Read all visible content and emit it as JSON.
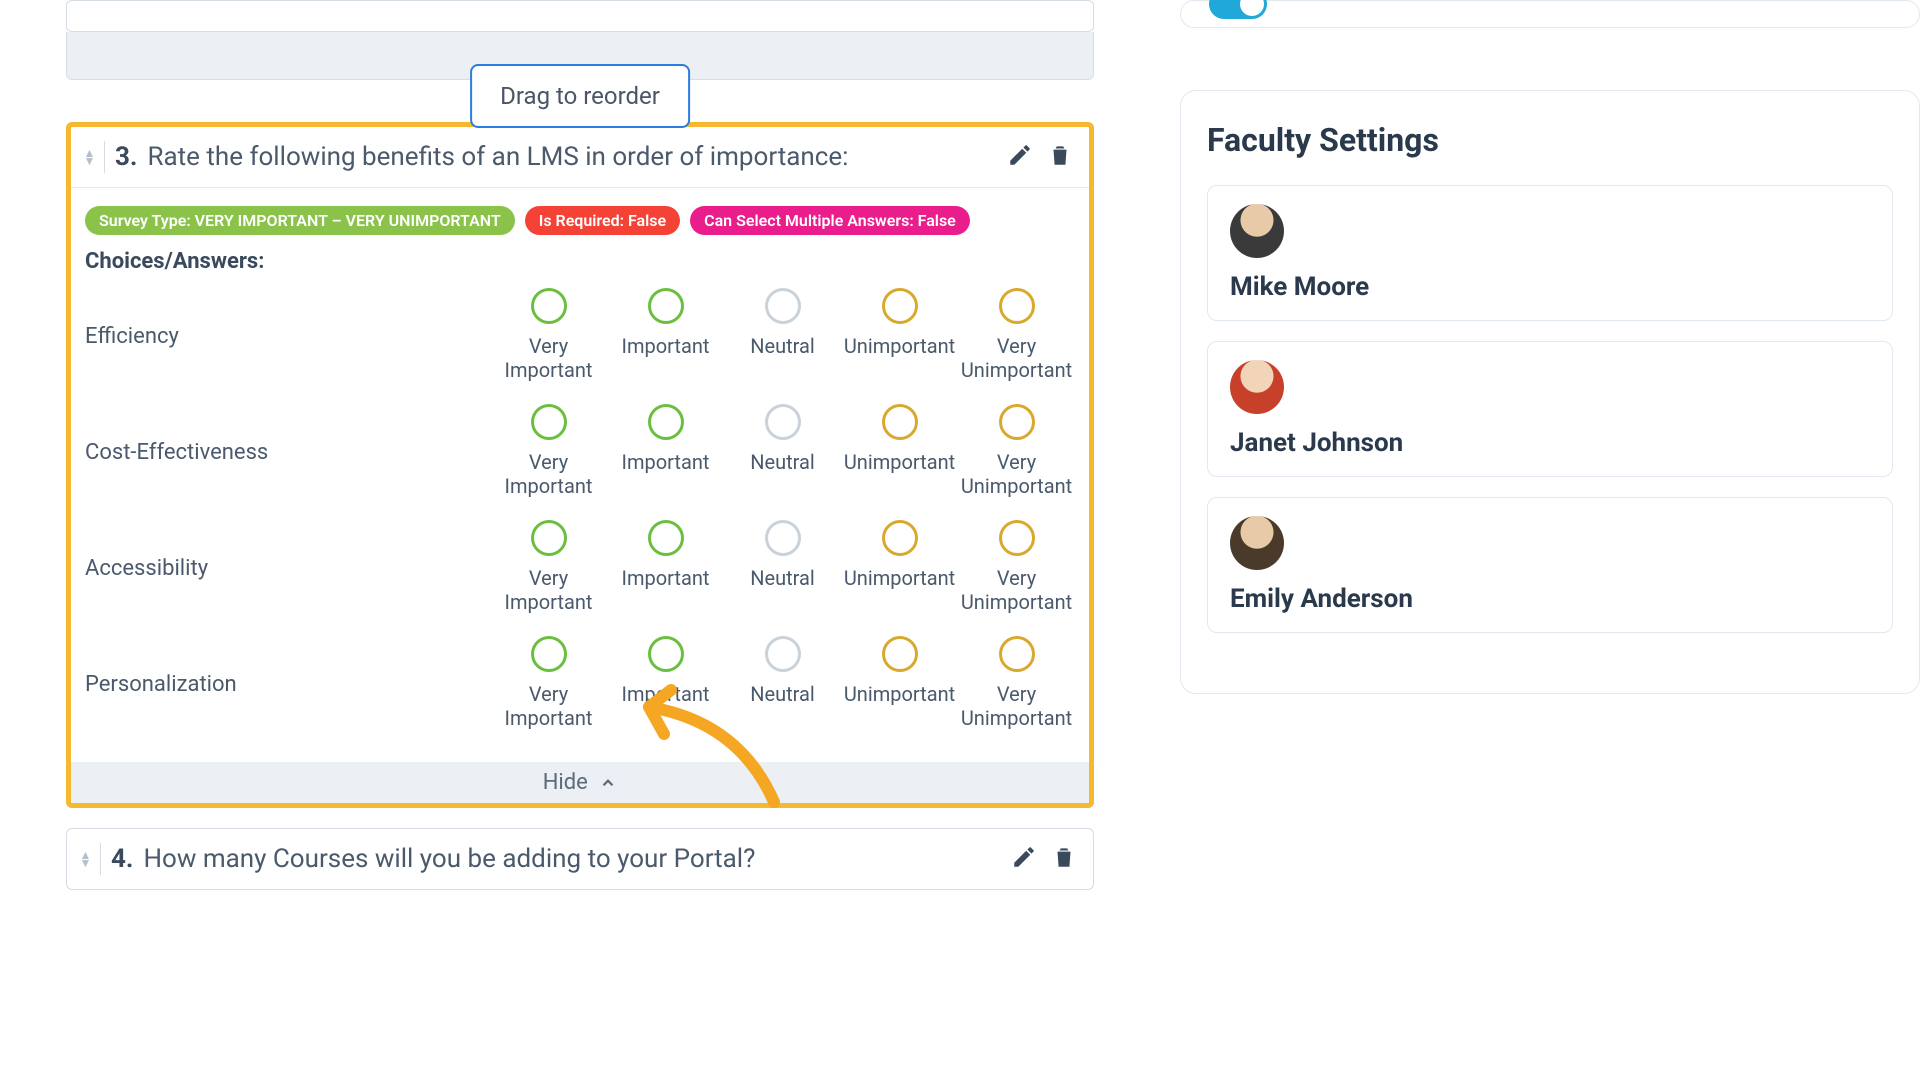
{
  "drag_label": "Drag to reorder",
  "question3": {
    "number": "3.",
    "text": "Rate the following benefits of an LMS in order of importance:",
    "pill_type": "Survey Type: VERY IMPORTANT – VERY UNIMPORTANT",
    "pill_required": "Is Required: False",
    "pill_multiple": "Can Select Multiple Answers: False",
    "choices_label": "Choices/Answers:",
    "rows": [
      "Efficiency",
      "Cost-Effectiveness",
      "Accessibility",
      "Personalization"
    ],
    "options": [
      {
        "label": "Very Important",
        "color": "c-green"
      },
      {
        "label": "Important",
        "color": "c-green"
      },
      {
        "label": "Neutral",
        "color": "c-gray"
      },
      {
        "label": "Unimportant",
        "color": "c-gold"
      },
      {
        "label": "Very Unimportant",
        "color": "c-gold"
      }
    ],
    "hide_label": "Hide"
  },
  "question4": {
    "number": "4.",
    "text": "How many Courses will you be adding to your Portal?"
  },
  "sidebar": {
    "title": "Faculty Settings",
    "faculty": [
      {
        "name": "Mike Moore",
        "avatar": "av1"
      },
      {
        "name": "Janet Johnson",
        "avatar": "av2"
      },
      {
        "name": "Emily Anderson",
        "avatar": "av3"
      }
    ]
  }
}
